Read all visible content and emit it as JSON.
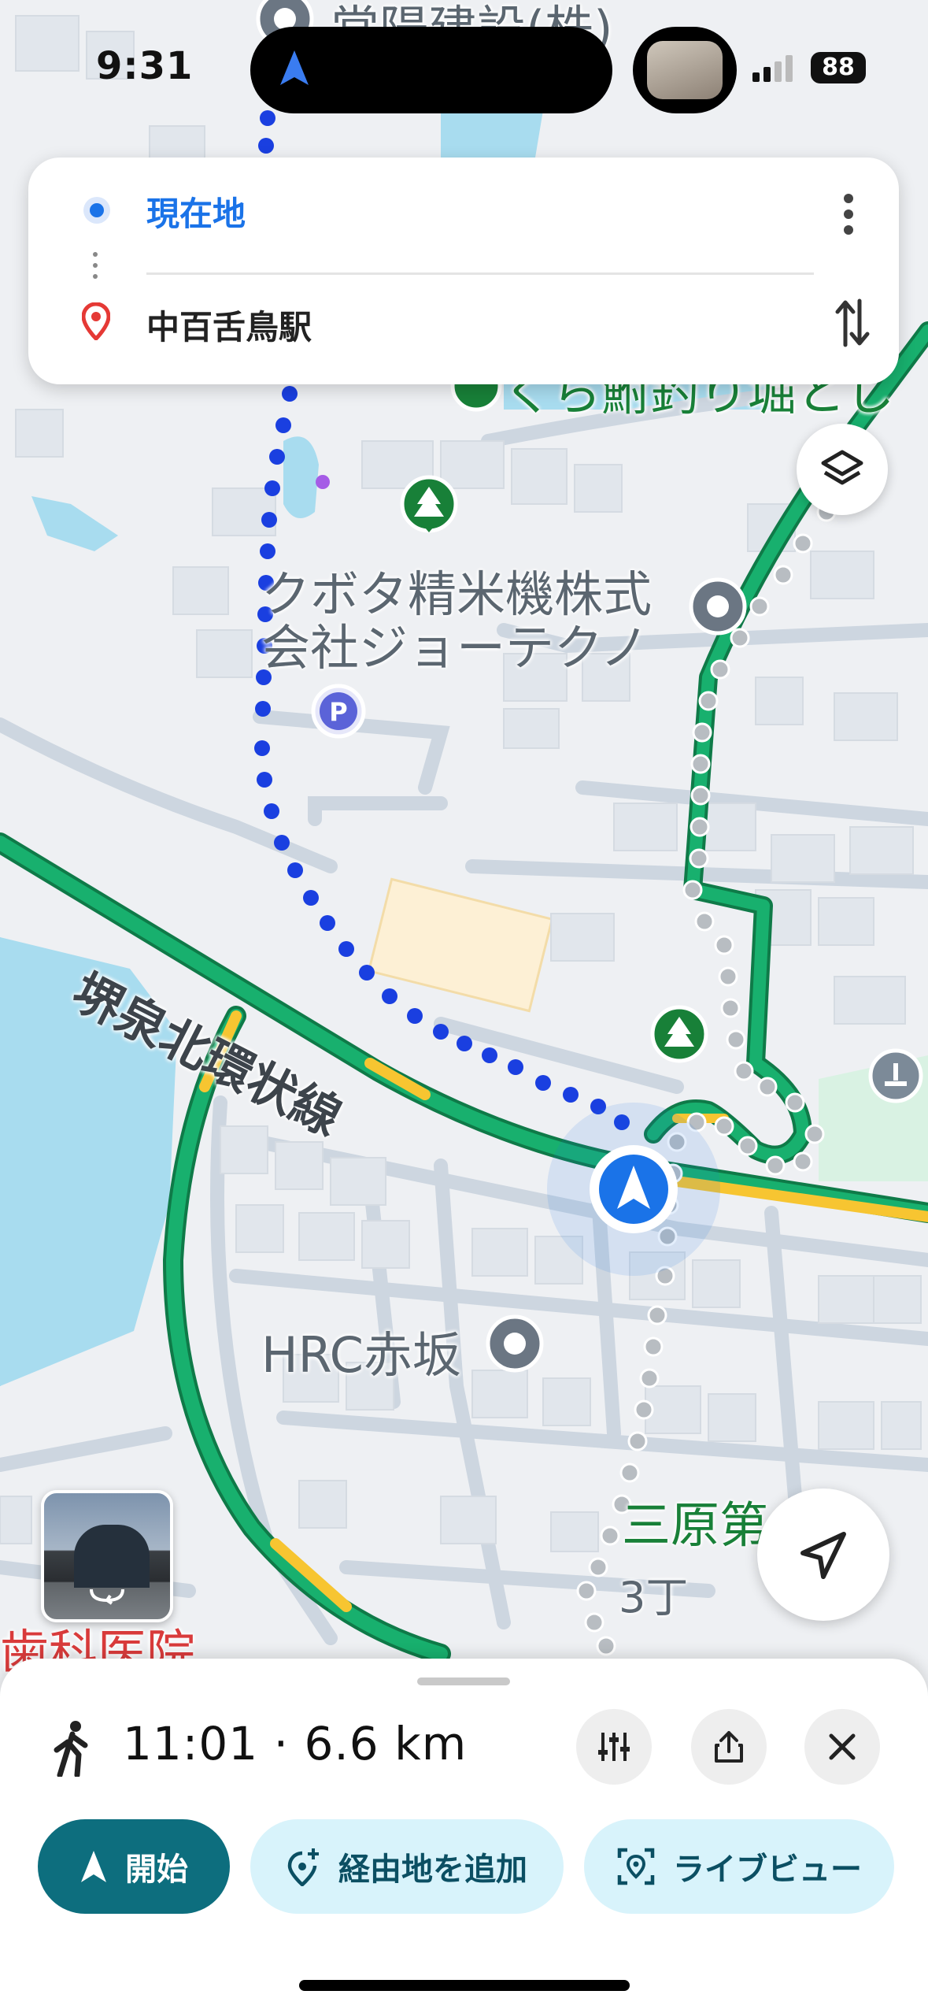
{
  "status_bar": {
    "time": "9:31",
    "battery": "88"
  },
  "directions_card": {
    "origin": "現在地",
    "destination": "中百舌鳥駅"
  },
  "map": {
    "labels": {
      "top_company": "常陽建設(株)",
      "fishing_pond": "くら鮒釣り堀とし",
      "company_line1": "クボタ精米機株式",
      "company_line2": "会社ジョーテクノ",
      "road": "堺泉北環状線",
      "hrc": "HRC赤坂",
      "park": "三原第　園",
      "block": "3丁",
      "clinic": "歯科医院"
    }
  },
  "bottom_sheet": {
    "summary": "11:01 · 6.6 km",
    "start_label": "開始",
    "add_waypoint_label": "経由地を追加",
    "live_view_label": "ライブビュー"
  },
  "colors": {
    "route_dots": "#1a3fe0",
    "accent": "#1a73e8",
    "start_button": "#0d6e7e",
    "pill_bg": "#d8f3fb",
    "road_green": "#18b06e",
    "road_yellow": "#f7c531",
    "water": "#a8dcef"
  },
  "icons": [
    "navigation-arrow-icon",
    "signal-icon",
    "more-vert-icon",
    "swap-icon",
    "pin-icon",
    "layers-icon",
    "my-location-icon",
    "walk-icon",
    "tune-icon",
    "share-icon",
    "close-icon",
    "add-location-icon",
    "live-view-icon",
    "park-icon",
    "parking-icon",
    "poi-icon"
  ]
}
